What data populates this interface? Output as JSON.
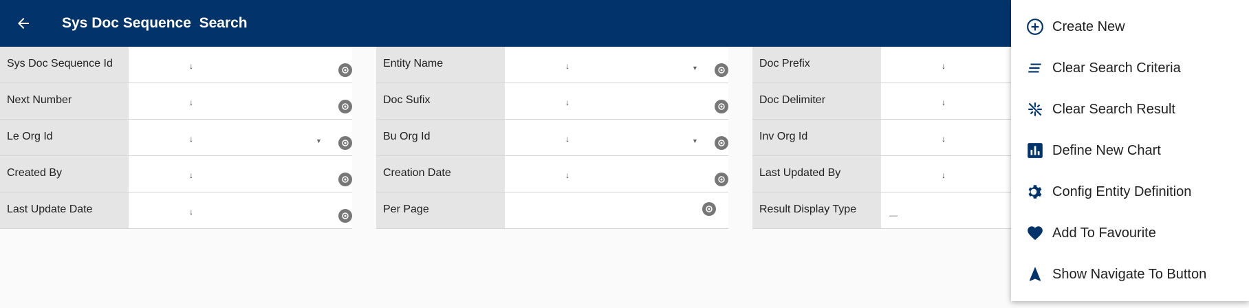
{
  "header": {
    "title": "Sys Doc Sequence  Search",
    "back_icon": "arrow-left-icon"
  },
  "form": {
    "columns": [
      {
        "fields": [
          {
            "label": "Sys Doc Sequence Id",
            "has_dropdown": false
          },
          {
            "label": "Next Number",
            "has_dropdown": false
          },
          {
            "label": "Le Org Id",
            "has_dropdown": true
          },
          {
            "label": "Created By",
            "has_dropdown": false
          },
          {
            "label": "Last Update Date",
            "has_dropdown": false
          }
        ]
      },
      {
        "fields": [
          {
            "label": "Entity Name",
            "has_dropdown": true
          },
          {
            "label": "Doc Sufix",
            "has_dropdown": false
          },
          {
            "label": "Bu Org Id",
            "has_dropdown": true
          },
          {
            "label": "Creation Date",
            "has_dropdown": false
          },
          {
            "label": "Per Page",
            "has_dropdown": false
          }
        ]
      },
      {
        "fields": [
          {
            "label": "Doc Prefix",
            "has_dropdown": false
          },
          {
            "label": "Doc Delimiter",
            "has_dropdown": false
          },
          {
            "label": "Inv Org Id",
            "has_dropdown": false
          },
          {
            "label": "Last Updated By",
            "has_dropdown": false
          },
          {
            "label": "Result Display Type",
            "has_dropdown": false
          }
        ]
      }
    ]
  },
  "menu": {
    "items": [
      {
        "label": "Create New",
        "icon": "add-circle-icon"
      },
      {
        "label": "Clear Search Criteria",
        "icon": "clear-lines-icon"
      },
      {
        "label": "Clear Search Result",
        "icon": "clear-all-icon"
      },
      {
        "label": "Define New Chart",
        "icon": "bar-chart-icon"
      },
      {
        "label": "Config Entity Definition",
        "icon": "gear-icon"
      },
      {
        "label": "Add To Favourite",
        "icon": "heart-icon"
      },
      {
        "label": "Show Navigate To Button",
        "icon": "navigation-arrow-icon"
      }
    ]
  },
  "colors": {
    "primary": "#02346b",
    "label_bg": "#e5e5e5",
    "icon_gray": "#777777"
  }
}
